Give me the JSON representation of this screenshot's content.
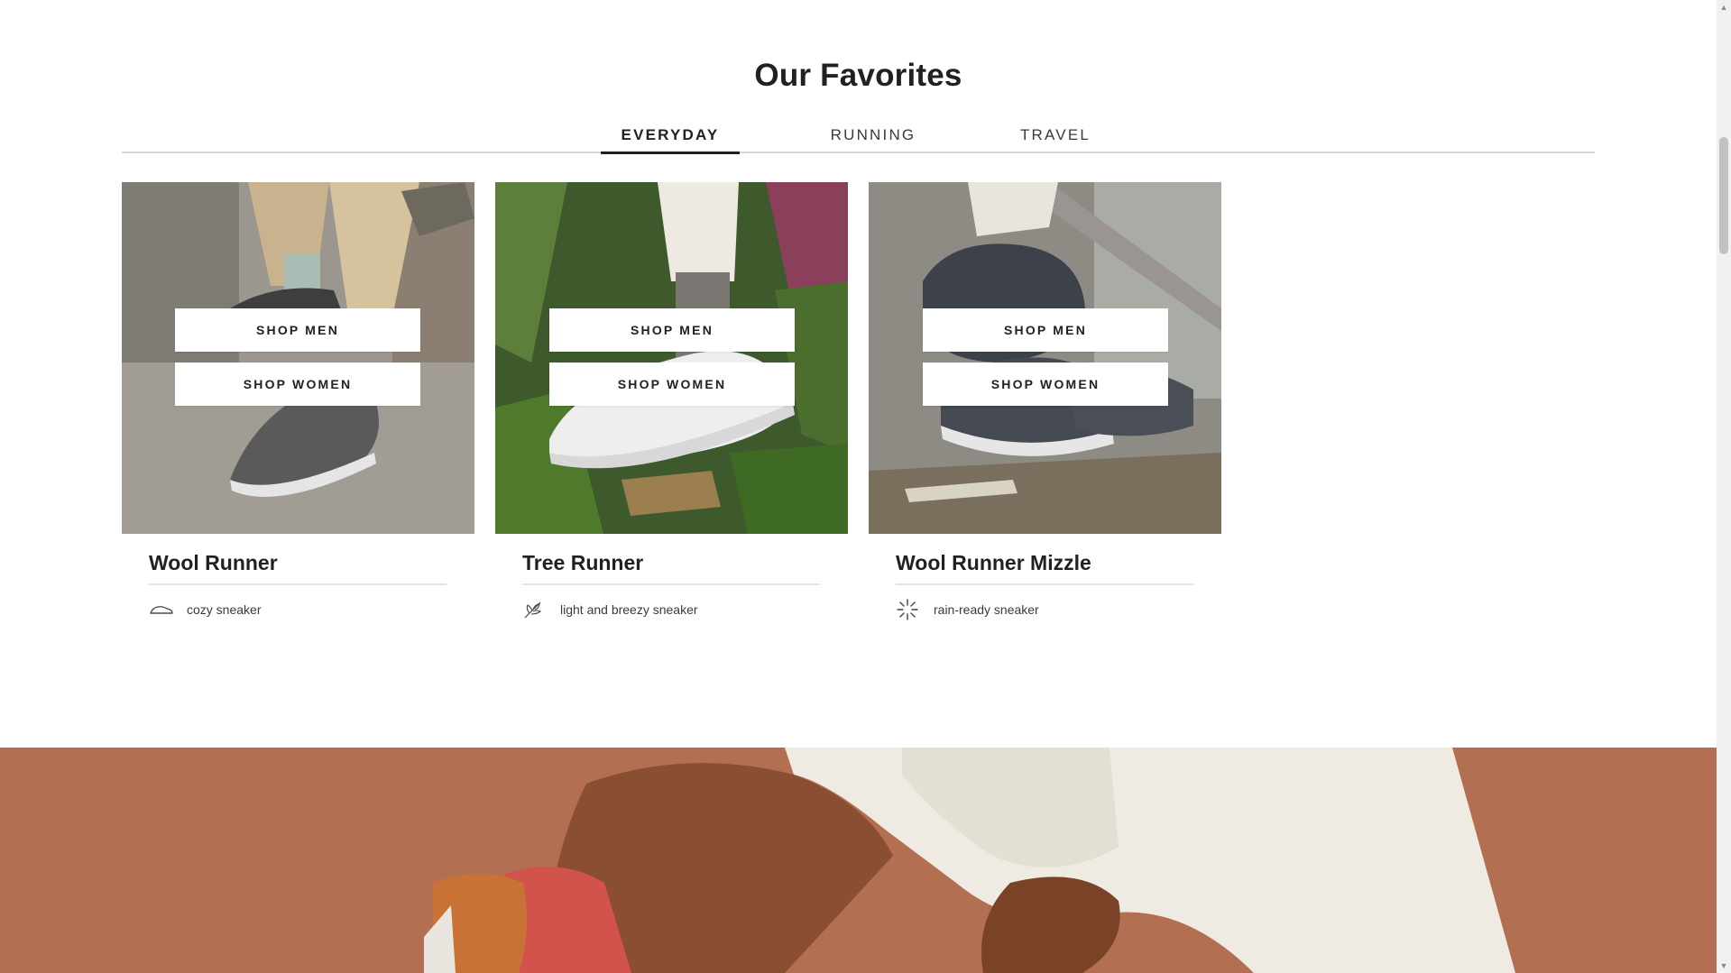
{
  "section": {
    "title": "Our Favorites"
  },
  "tabs": [
    {
      "label": "EVERYDAY",
      "active": true
    },
    {
      "label": "RUNNING",
      "active": false
    },
    {
      "label": "TRAVEL",
      "active": false
    }
  ],
  "products": [
    {
      "name": "Wool Runner",
      "description": "cozy sneaker",
      "icon": "sneaker-icon",
      "shop_men": "SHOP MEN",
      "shop_women": "SHOP WOMEN"
    },
    {
      "name": "Tree Runner",
      "description": "light and breezy sneaker",
      "icon": "leaf-icon",
      "shop_men": "SHOP MEN",
      "shop_women": "SHOP WOMEN"
    },
    {
      "name": "Wool Runner Mizzle",
      "description": "rain-ready sneaker",
      "icon": "rain-burst-icon",
      "shop_men": "SHOP MEN",
      "shop_women": "SHOP WOMEN"
    }
  ],
  "colors": {
    "hero_background": "#b26f51",
    "text": "#212121",
    "divider": "#d6d6d6"
  },
  "scrollbar": {
    "up_arrow": "▲",
    "down_arrow": "▼"
  }
}
